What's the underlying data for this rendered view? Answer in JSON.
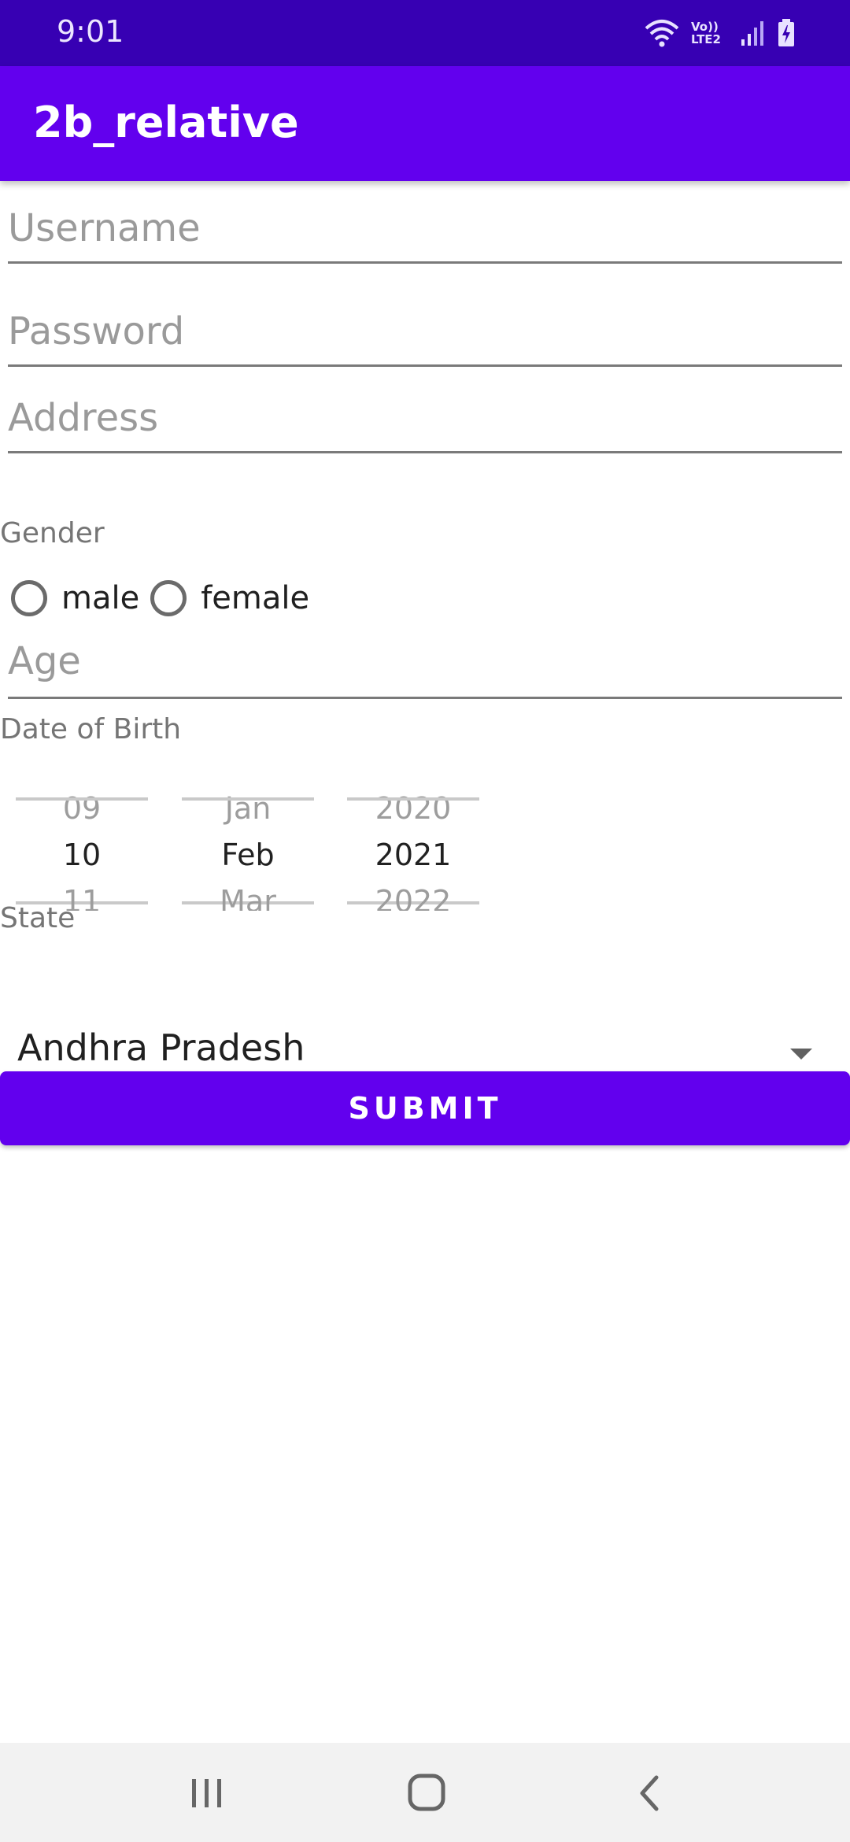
{
  "status_bar": {
    "time": "9:01",
    "network_label": "Vo)) LTE2",
    "icons": [
      "wifi-icon",
      "volte-icon",
      "signal-icon",
      "battery-charging-icon"
    ]
  },
  "app_bar": {
    "title": "2b_relative"
  },
  "form": {
    "username_placeholder": "Username",
    "password_placeholder": "Password",
    "address_placeholder": "Address",
    "gender_label": "Gender",
    "gender_options": [
      "male",
      "female"
    ],
    "age_placeholder": "Age",
    "dob_label": "Date of Birth",
    "date_picker": {
      "day": {
        "prev": "09",
        "selected": "10",
        "next": "11"
      },
      "month": {
        "prev": "Jan",
        "selected": "Feb",
        "next": "Mar"
      },
      "year": {
        "prev": "2020",
        "selected": "2021",
        "next": "2022"
      }
    },
    "state_label": "State",
    "state_selected": "Andhra Pradesh",
    "submit_label": "SUBMIT"
  },
  "nav_bar": {
    "icons": [
      "recents-icon",
      "home-icon",
      "back-icon"
    ]
  },
  "colors": {
    "primary": "#6200EE",
    "primary_dark": "#3700B3"
  }
}
